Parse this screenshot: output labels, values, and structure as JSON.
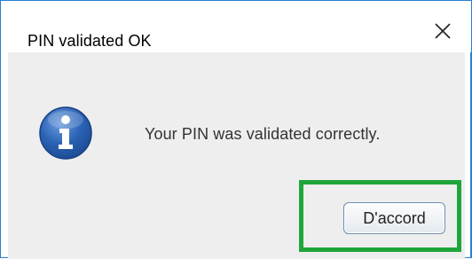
{
  "dialog": {
    "title": "PIN validated OK",
    "message": "Your PIN was validated correctly.",
    "ok_label": "D'accord",
    "icon": "info-icon",
    "close_icon": "close-icon"
  },
  "colors": {
    "window_border": "#2b7fd4",
    "client_background": "#eeeeee",
    "highlight": "#1fa53a",
    "info_icon": "#2a62b4",
    "button_border": "#6d8fb1"
  }
}
